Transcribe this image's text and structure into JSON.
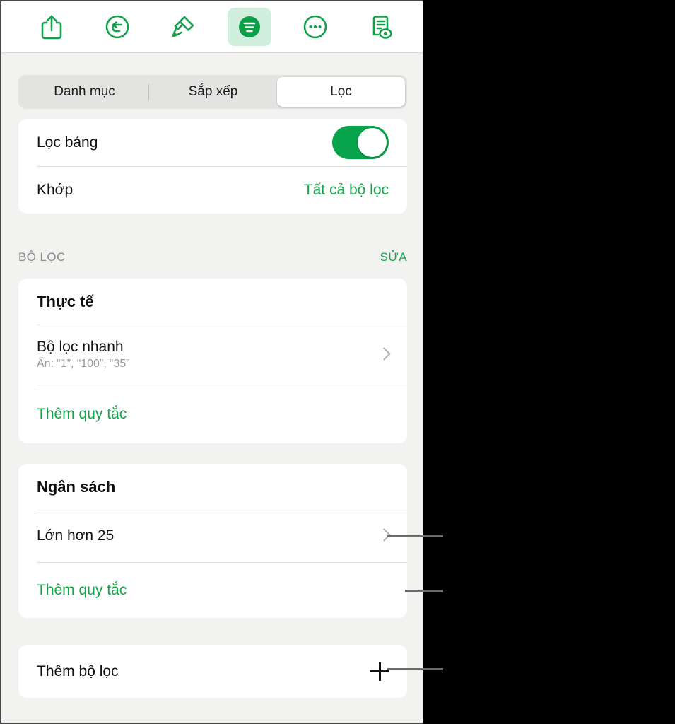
{
  "toolbar": {
    "buttons": [
      {
        "name": "share-icon",
        "label": "Chia sẻ"
      },
      {
        "name": "undo-icon",
        "label": "Hoàn tác"
      },
      {
        "name": "paintbrush-icon",
        "label": "Định dạng"
      },
      {
        "name": "filter-sort-icon",
        "label": "Sắp xếp và lọc"
      },
      {
        "name": "more-icon",
        "label": "Thêm"
      },
      {
        "name": "present-icon",
        "label": "Trình chiếu"
      }
    ]
  },
  "segmented": {
    "tabs": [
      {
        "label": "Danh mục",
        "selected": false
      },
      {
        "label": "Sắp xếp",
        "selected": false
      },
      {
        "label": "Lọc",
        "selected": true
      }
    ]
  },
  "settings_card": {
    "filter_table": {
      "label": "Lọc bảng",
      "toggle_on": true
    },
    "match": {
      "label": "Khớp",
      "value": "Tất cả bộ lọc"
    }
  },
  "section": {
    "title": "BỘ LỌC",
    "action": "SỬA"
  },
  "filters": [
    {
      "name": "Thực tế",
      "rules": [
        {
          "label": "Bộ lọc nhanh",
          "sublabel": "Ẩn: “1”, “100”, “35”",
          "accessory": "chevron"
        }
      ],
      "add_rule": "Thêm quy tắc"
    },
    {
      "name": "Ngân sách",
      "rules": [
        {
          "label": "Lớn hơn 25",
          "sublabel": "",
          "accessory": "chevron"
        }
      ],
      "add_rule": "Thêm quy tắc"
    }
  ],
  "add_filter": {
    "label": "Thêm bộ lọc",
    "accessory": "plus"
  },
  "colors": {
    "accent_green": "#16a34a",
    "toggle_green": "#08a44b",
    "icon_green": "#13a24b",
    "active_button_bg": "#cfeedc",
    "panel_bg": "#f2f2f1",
    "card_bg": "#ffffff",
    "callout_line": "#6b6b6b"
  }
}
